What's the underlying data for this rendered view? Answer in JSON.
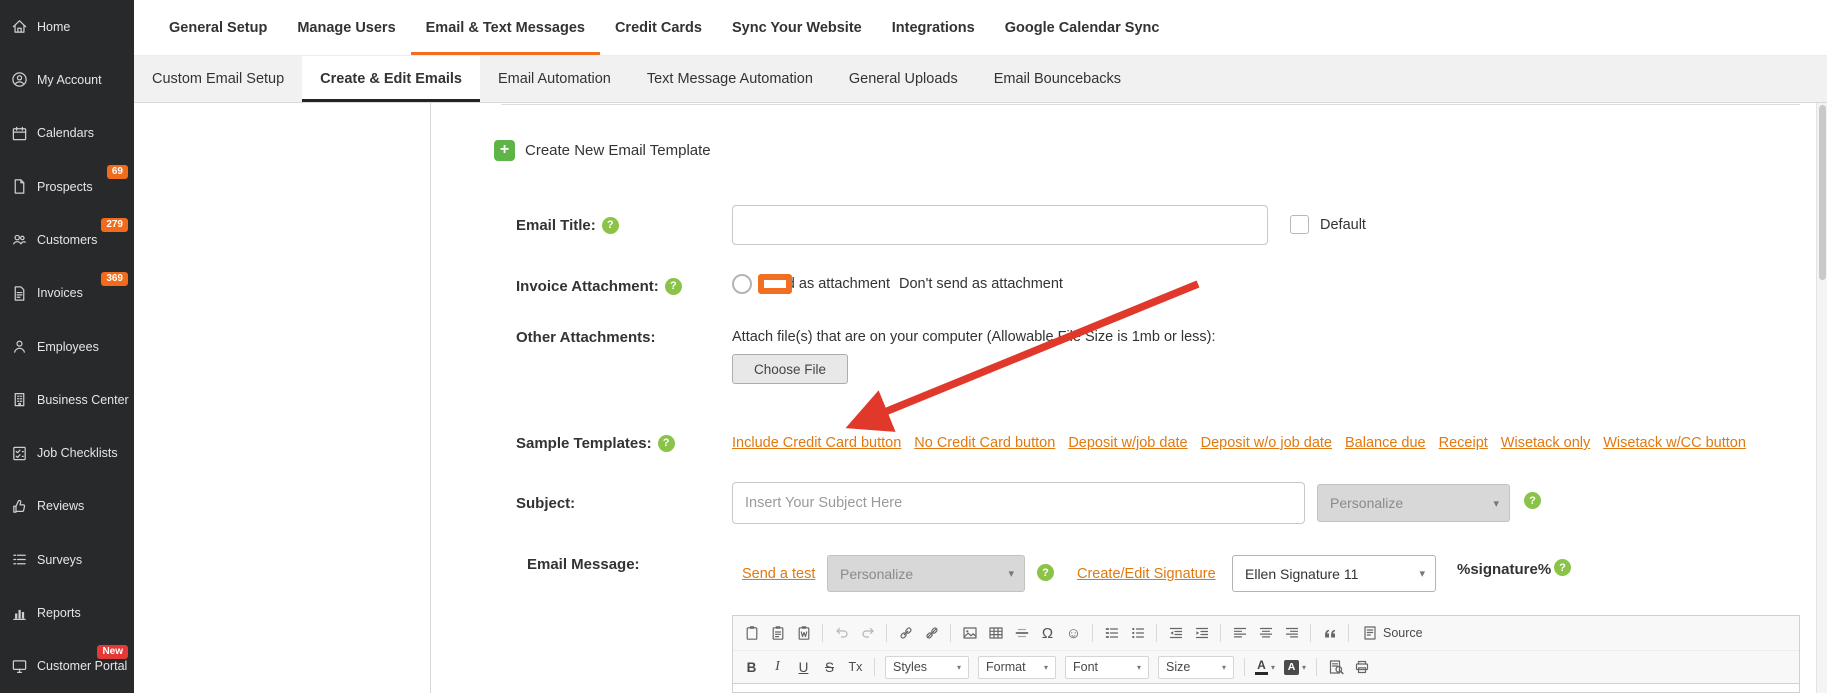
{
  "misc": {
    "help": "?",
    "chevron": "▾",
    "plus": "+"
  },
  "sidebar": {
    "items": [
      {
        "label": "Home",
        "icon": "home-icon"
      },
      {
        "label": "My Account",
        "icon": "account-icon"
      },
      {
        "label": "Calendars",
        "icon": "calendar-icon"
      },
      {
        "label": "Prospects",
        "icon": "prospects-file-icon",
        "badge": "69"
      },
      {
        "label": "Customers",
        "icon": "customers-group-icon",
        "badge": "279"
      },
      {
        "label": "Invoices",
        "icon": "invoices-file-icon",
        "badge": "369"
      },
      {
        "label": "Employees",
        "icon": "employee-icon"
      },
      {
        "label": "Business Center",
        "icon": "business-building-icon"
      },
      {
        "label": "Job Checklists",
        "icon": "job-checklist-icon"
      },
      {
        "label": "Reviews",
        "icon": "thumbs-up-icon"
      },
      {
        "label": "Surveys",
        "icon": "survey-lines-icon"
      },
      {
        "label": "Reports",
        "icon": "reports-bar-chart-icon"
      },
      {
        "label": "Customer Portal",
        "icon": "customer-portal-monitor-icon",
        "badge": "New"
      }
    ]
  },
  "topnav": {
    "active": "Email & Text Messages",
    "items": [
      {
        "label": "General Setup"
      },
      {
        "label": "Manage Users"
      },
      {
        "label": "Email & Text Messages"
      },
      {
        "label": "Credit Cards"
      },
      {
        "label": "Sync Your Website"
      },
      {
        "label": "Integrations"
      },
      {
        "label": "Google Calendar Sync"
      }
    ]
  },
  "subnav": {
    "active": "Create & Edit Emails",
    "items": [
      {
        "label": "Custom Email Setup"
      },
      {
        "label": "Create & Edit Emails"
      },
      {
        "label": "Email Automation"
      },
      {
        "label": "Text Message Automation"
      },
      {
        "label": "General Uploads"
      },
      {
        "label": "Email Bouncebacks"
      }
    ]
  },
  "form": {
    "create_new": "Create New Email Template",
    "email_title": {
      "label": "Email Title:",
      "value": "",
      "default_label": "Default",
      "default_checked": false
    },
    "invoice": {
      "label": "Invoice Attachment:",
      "options": [
        "Send as attachment",
        "Don't send as attachment"
      ],
      "selected": "Don't send as attachment"
    },
    "other": {
      "label": "Other Attachments:",
      "hint": "Attach file(s) that are on your computer (Allowable File Size is 1mb or less):",
      "button": "Choose File"
    },
    "samples": {
      "label": "Sample Templates:",
      "links": [
        "Include Credit Card button",
        "No Credit Card button",
        "Deposit w/job date",
        "Deposit w/o job date",
        "Balance due",
        "Receipt",
        "Wisetack only",
        "Wisetack w/CC button"
      ]
    },
    "subject": {
      "label": "Subject:",
      "value": "",
      "placeholder": "Insert Your Subject Here",
      "personalize": "Personalize"
    },
    "message": {
      "label": "Email Message:",
      "send_test": "Send a test",
      "personalize": "Personalize",
      "create_edit": "Create/Edit Signature",
      "signature_value": "Ellen Signature 11",
      "token": "%signature%"
    }
  },
  "editor": {
    "source": "Source",
    "styles": "Styles",
    "format": "Format",
    "font": "Font",
    "size": "Size",
    "bold": "B",
    "italic": "I",
    "underline": "U",
    "strike": "S",
    "remove_format": "Tx",
    "special_char": "Ω",
    "smiley": "☺",
    "toolbar_row1": [
      "paste-icon",
      "paste-plain-text-icon",
      "paste-from-word-icon",
      "undo-icon",
      "redo-icon",
      "link-icon",
      "unlink-icon",
      "image-icon",
      "table-icon",
      "horizontal-rule-icon",
      "special-char-icon",
      "smiley-icon",
      "numbered-list-icon",
      "bulleted-list-icon",
      "outdent-icon",
      "indent-icon",
      "align-left-icon",
      "align-center-icon",
      "align-right-icon",
      "blockquote-icon",
      "source-icon"
    ],
    "toolbar_row2": [
      "bold-button",
      "italic-button",
      "underline-button",
      "strikethrough-button",
      "remove-format-button",
      "styles-combo",
      "format-combo",
      "font-combo",
      "size-combo",
      "text-color-icon",
      "bg-color-icon",
      "preview-icon",
      "print-icon"
    ]
  },
  "colors": {
    "accent_orange": "#f26f21",
    "link_orange": "#e0790f",
    "help_green": "#8bc34a",
    "badge_orange": "#f26b1d",
    "badge_red": "#e53935",
    "arrow_red": "#e1382c",
    "sidebar_bg": "#28292b",
    "subnav_bg": "#f1f1f1"
  }
}
